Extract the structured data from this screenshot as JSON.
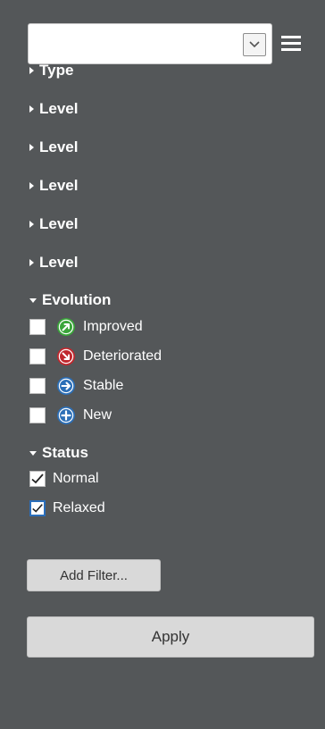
{
  "select": {
    "value": ""
  },
  "sections": {
    "type": "Type",
    "levels": [
      "Level",
      "Level",
      "Level",
      "Level",
      "Level"
    ],
    "evolution": "Evolution",
    "status": "Status"
  },
  "evolution_items": [
    {
      "label": "Improved",
      "checked": false,
      "icon": "improved-arrow-icon",
      "color": "#3aa53a"
    },
    {
      "label": "Deteriorated",
      "checked": false,
      "icon": "deteriorated-arrow-icon",
      "color": "#c0282e"
    },
    {
      "label": "Stable",
      "checked": false,
      "icon": "stable-arrow-icon",
      "color": "#2c6fb7"
    },
    {
      "label": "New",
      "checked": false,
      "icon": "new-plus-icon",
      "color": "#2c6fb7"
    }
  ],
  "status_items": [
    {
      "label": "Normal",
      "checked": true
    },
    {
      "label": "Relaxed",
      "checked": true
    }
  ],
  "buttons": {
    "add_filter": "Add Filter...",
    "apply": "Apply"
  },
  "colors": {
    "background": "#545759",
    "button": "#d9d9d9"
  }
}
